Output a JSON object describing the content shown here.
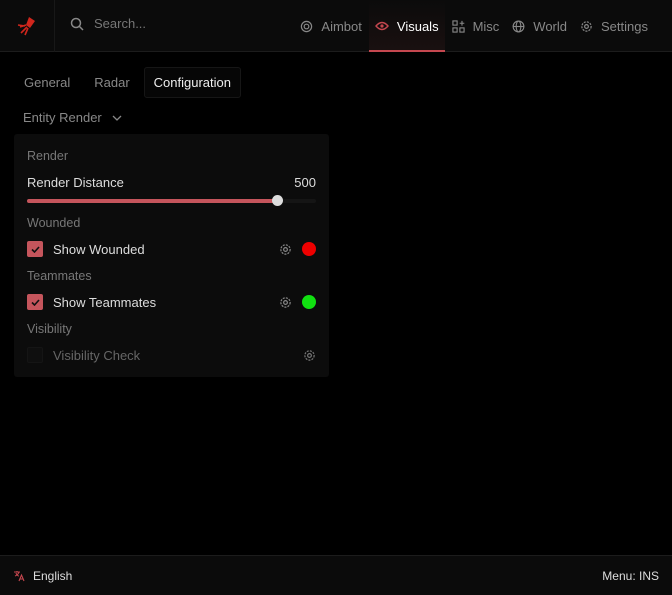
{
  "header": {
    "search_placeholder": "Search...",
    "nav": [
      {
        "label": "Aimbot",
        "icon": "target-icon"
      },
      {
        "label": "Visuals",
        "icon": "eye-icon"
      },
      {
        "label": "Misc",
        "icon": "grid-icon"
      },
      {
        "label": "World",
        "icon": "globe-icon"
      },
      {
        "label": "Settings",
        "icon": "gear-icon"
      }
    ],
    "active_nav": "Visuals"
  },
  "tabs": [
    "General",
    "Radar",
    "Configuration"
  ],
  "active_tab": "Configuration",
  "dropdown": {
    "value": "Entity Render"
  },
  "panel": {
    "render_section": "Render",
    "render_distance": {
      "label": "Render Distance",
      "value": "500",
      "fill_fraction": 0.865
    },
    "wounded_section": "Wounded",
    "show_wounded": {
      "label": "Show Wounded",
      "checked": true,
      "color": "#ee0000"
    },
    "teammates_section": "Teammates",
    "show_teammates": {
      "label": "Show Teammates",
      "checked": true,
      "color": "#11e011"
    },
    "visibility_section": "Visibility",
    "visibility_check": {
      "label": "Visibility Check",
      "checked": false
    }
  },
  "footer": {
    "language": "English",
    "menu_key": "Menu: INS"
  },
  "colors": {
    "accent": "#c5555c"
  }
}
